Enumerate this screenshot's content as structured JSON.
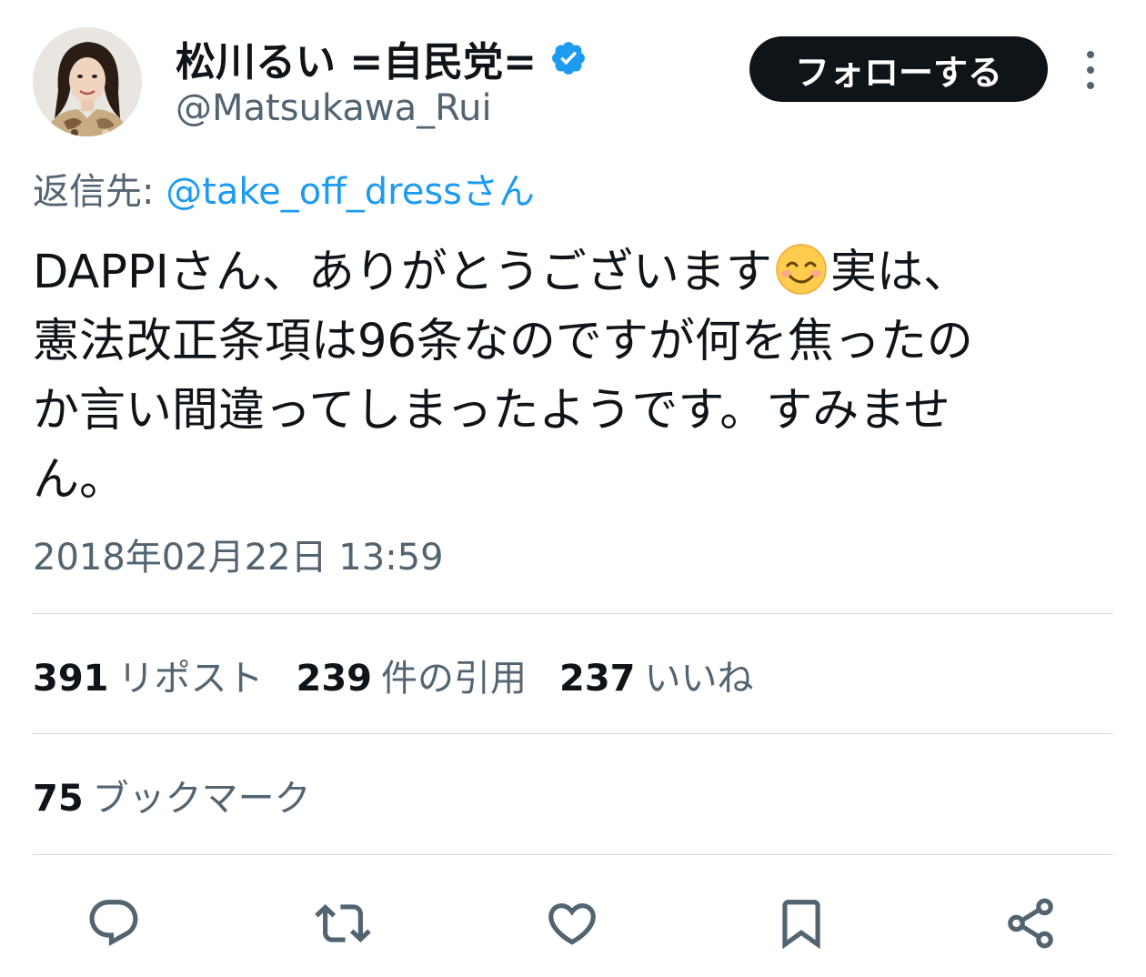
{
  "author": {
    "display_name": "松川るい =自民党=",
    "handle": "@Matsukawa_Rui",
    "verified_icon": "verified-badge-icon",
    "avatar_icon": "profile-photo"
  },
  "follow_button": {
    "label": "フォローする"
  },
  "more_icon": "more-vertical-icon",
  "reply": {
    "prefix": "返信先:",
    "target": "@take_off_dressさん"
  },
  "tweet": {
    "line1_before_emoji": "DAPPIさん、ありがとうございます",
    "emoji": "smiling-face-emoji",
    "line1_after_emoji": "実は、",
    "line2": "憲法改正条項は96条なのですが何を焦ったの",
    "line3": "か言い間違ってしまったようです。すみませ",
    "line4": "ん。"
  },
  "timestamp": "2018年02月22日 13:59",
  "stats": {
    "reposts": {
      "count": "391",
      "label": "リポスト"
    },
    "quotes": {
      "count": "239",
      "label": "件の引用"
    },
    "likes": {
      "count": "237",
      "label": "いいね"
    },
    "bookmarks": {
      "count": "75",
      "label": "ブックマーク"
    }
  },
  "actions": [
    {
      "name": "reply",
      "icon": "reply-bubble-icon"
    },
    {
      "name": "repost",
      "icon": "repost-arrows-icon"
    },
    {
      "name": "like",
      "icon": "heart-icon"
    },
    {
      "name": "bookmark",
      "icon": "bookmark-icon"
    },
    {
      "name": "share",
      "icon": "share-icon"
    }
  ],
  "colors": {
    "text_primary": "#0f1419",
    "text_secondary": "#536471",
    "accent_blue": "#1d9bf0",
    "divider": "#cfd9de",
    "follow_button_bg": "#0f1419"
  }
}
